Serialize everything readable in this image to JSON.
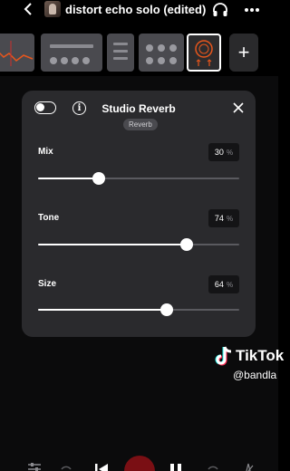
{
  "header": {
    "title": "distort echo solo (edited)"
  },
  "fx_chain": {
    "add_label": "+"
  },
  "panel": {
    "title": "Studio Reverb",
    "preset": "Reverb",
    "enabled": true,
    "params": [
      {
        "label": "Mix",
        "value": "30",
        "unit": "%",
        "level": 0.3
      },
      {
        "label": "Tone",
        "value": "74",
        "unit": "%",
        "level": 0.74
      },
      {
        "label": "Size",
        "value": "64",
        "unit": "%",
        "level": 0.64
      }
    ]
  },
  "watermark": {
    "brand": "TikTok",
    "handle": "@bandla"
  },
  "colors": {
    "background": "#000000",
    "panel": "#2a2a2d",
    "record": "#7a0f14",
    "active_fx_icon": "#e8561c"
  }
}
